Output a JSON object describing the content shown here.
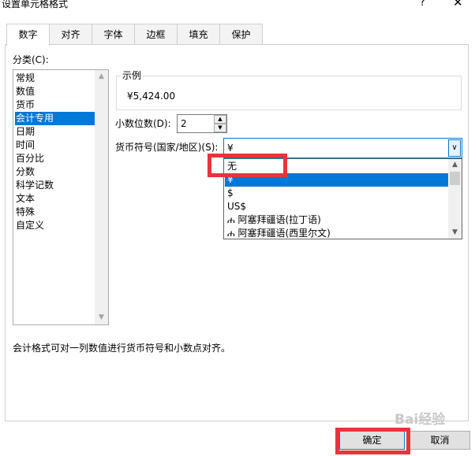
{
  "window": {
    "title": "设置单元格格式",
    "help": "?",
    "close": "✕"
  },
  "tabs": [
    "数字",
    "对齐",
    "字体",
    "边框",
    "填充",
    "保护"
  ],
  "category": {
    "label": "分类(C):",
    "items": [
      "常规",
      "数值",
      "货币",
      "会计专用",
      "日期",
      "时间",
      "百分比",
      "分数",
      "科学记数",
      "文本",
      "特殊",
      "自定义"
    ],
    "selected": "会计专用"
  },
  "sample": {
    "title": "示例",
    "value": "¥5,424.00"
  },
  "decimal": {
    "label": "小数位数(D):",
    "value": "2"
  },
  "currency": {
    "label": "货币符号(国家/地区)(S):",
    "value": "¥",
    "options": [
      "无",
      "¥",
      "$",
      "US$",
      "ሐ 阿塞拜疆语(拉丁语)",
      "ሐ 阿塞拜疆语(西里尔文)"
    ],
    "selected_index": 1
  },
  "description": "会计格式可对一列数值进行货币符号和小数点对齐。",
  "buttons": {
    "ok": "确定",
    "cancel": "取消"
  },
  "watermark": "Bai经验",
  "colors": {
    "accent": "#0078d7",
    "highlight": "#e8343a"
  }
}
